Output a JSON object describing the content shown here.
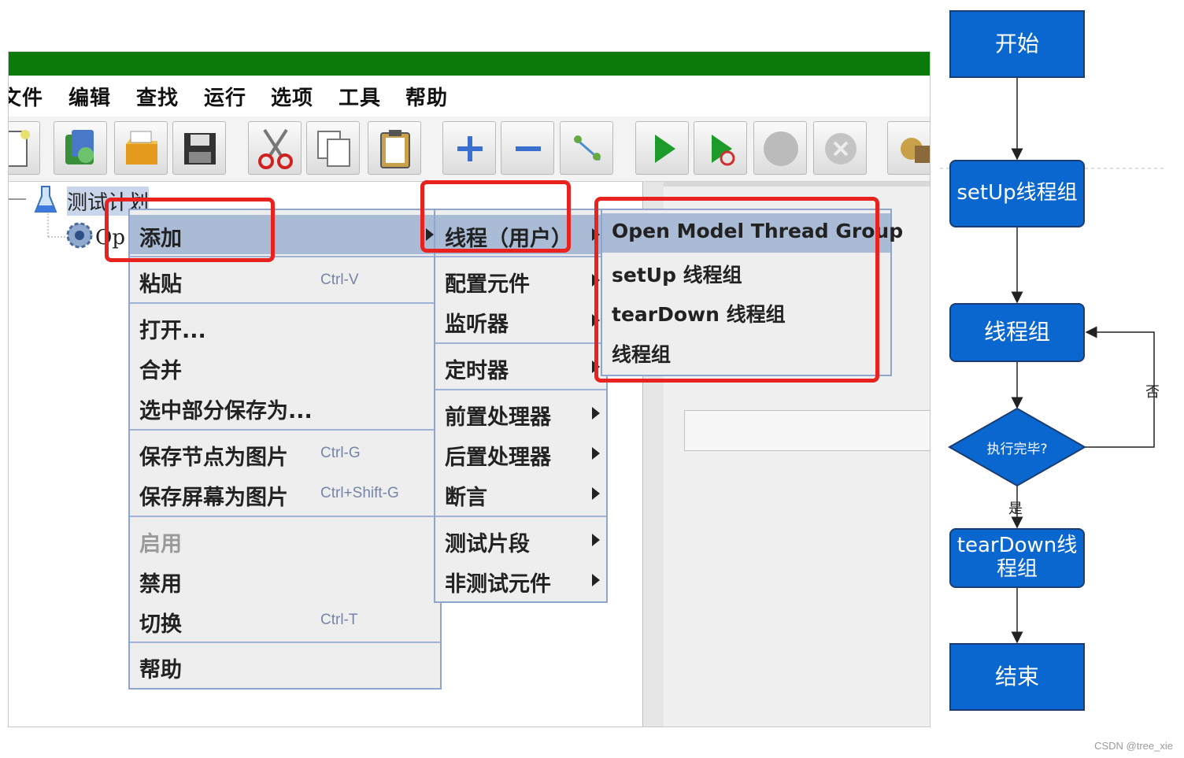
{
  "menubar": [
    "文件",
    "编辑",
    "查找",
    "运行",
    "选项",
    "工具",
    "帮助"
  ],
  "toolbar_icons": [
    "new-icon",
    "templates-icon",
    "open-icon",
    "save-icon",
    "cut-icon",
    "copy-icon",
    "paste-icon",
    "expand-icon",
    "collapse-icon",
    "toggle-icon",
    "start-icon",
    "start-no-pause-icon",
    "stop-icon",
    "shutdown-icon",
    "clear-icon"
  ],
  "tree": {
    "root": "测试计划",
    "child": "Op"
  },
  "context_menu": {
    "items": [
      {
        "label": "添加",
        "shortcut": "",
        "submenu": true,
        "selected": true,
        "disabled": false
      },
      {
        "label": "粘贴",
        "shortcut": "Ctrl-V"
      },
      {
        "label": "打开...",
        "shortcut": ""
      },
      {
        "label": "合并",
        "shortcut": ""
      },
      {
        "label": "选中部分保存为...",
        "shortcut": ""
      },
      {
        "label": "保存节点为图片",
        "shortcut": "Ctrl-G"
      },
      {
        "label": "保存屏幕为图片",
        "shortcut": "Ctrl+Shift-G"
      },
      {
        "label": "启用",
        "shortcut": "",
        "disabled": true
      },
      {
        "label": "禁用",
        "shortcut": ""
      },
      {
        "label": "切换",
        "shortcut": "Ctrl-T"
      },
      {
        "label": "帮助",
        "shortcut": ""
      }
    ]
  },
  "add_submenu": {
    "items": [
      "线程（用户）",
      "配置元件",
      "监听器",
      "定时器",
      "前置处理器",
      "后置处理器",
      "断言",
      "测试片段",
      "非测试元件"
    ]
  },
  "thread_submenu": {
    "items": [
      "Open Model Thread Group",
      "setUp 线程组",
      "tearDown 线程组",
      "线程组"
    ]
  },
  "flowchart": {
    "nodes": [
      "开始",
      "setUp线程组",
      "线程组",
      "执行完毕?",
      "tearDown线程组",
      "结束"
    ],
    "yes_label": "是",
    "no_label": "否"
  },
  "colors": {
    "node_fill": "#0a67d0",
    "highlight_box": "#e8231f",
    "titlebar": "#0b7a0b",
    "menu_selected": "#aabbd6"
  },
  "watermark": "CSDN @tree_xie"
}
